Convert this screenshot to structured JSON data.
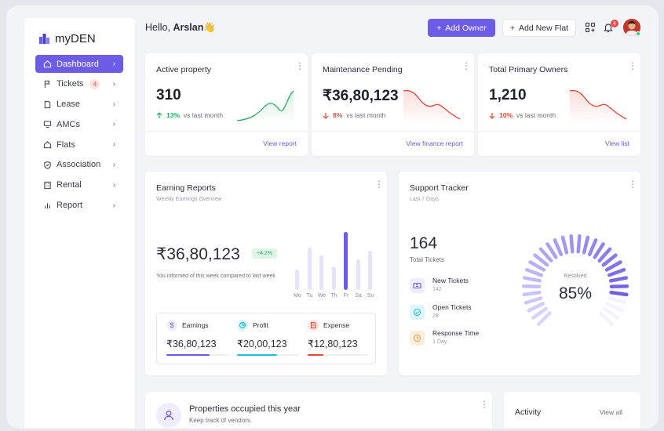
{
  "app": {
    "name": "myDEN"
  },
  "colors": {
    "accent": "#6c5ce7",
    "up": "#27ae60",
    "down": "#e5483a",
    "expense": "#e5483a",
    "profit": "#1ec1e6"
  },
  "sidebar": {
    "items": [
      {
        "label": "Dashboard",
        "icon": "home-icon",
        "active": true
      },
      {
        "label": "Tickets",
        "icon": "flag-icon",
        "badge": "4"
      },
      {
        "label": "Lease",
        "icon": "document-icon"
      },
      {
        "label": "AMCs",
        "icon": "monitor-icon"
      },
      {
        "label": "Flats",
        "icon": "home-outline-icon"
      },
      {
        "label": "Association",
        "icon": "shield-icon"
      },
      {
        "label": "Rental",
        "icon": "building-icon"
      },
      {
        "label": "Report",
        "icon": "bar-chart-icon"
      }
    ]
  },
  "header": {
    "greeting_prefix": "Hello, ",
    "user_name": "Arslan",
    "wave": "👋",
    "add_owner": "Add Owner",
    "add_flat": "Add New Flat",
    "notification_count": "4"
  },
  "kpis": [
    {
      "title": "Active property",
      "value": "310",
      "change": "13%",
      "direction": "up",
      "note": "vs last month",
      "link": "View report"
    },
    {
      "title": "Maintenance Pending",
      "value": "₹36,80,123",
      "change": "8%",
      "direction": "down",
      "note": "vs last month",
      "link": "View finance report"
    },
    {
      "title": "Total Primary Owners",
      "value": "1,210",
      "change": "10%",
      "direction": "down",
      "note": "vs last month",
      "link": "View list"
    }
  ],
  "earnings": {
    "title": "Earning Reports",
    "subtitle": "Weekly Earnings Overview",
    "value": "₹36,80,123",
    "badge": "+4.2%",
    "note": "You informed of this week compared to last week",
    "days": [
      "Mo",
      "Tu",
      "We",
      "Th",
      "Fr",
      "Sa",
      "Su"
    ],
    "bar_levels": [
      0.33,
      0.68,
      0.55,
      0.38,
      0.92,
      0.49,
      0.63
    ],
    "highlight_index": 4,
    "breakdown": [
      {
        "label": "Earnings",
        "value": "₹36,80,123",
        "icon": "dollar-icon",
        "color": "#6c5ce7",
        "bg": "#efedfd",
        "fill": 0.7
      },
      {
        "label": "Profit",
        "value": "₹20,00,123",
        "icon": "pie-chart-icon",
        "color": "#1ec1e6",
        "bg": "#dcf6fc",
        "fill": 0.65
      },
      {
        "label": "Expense",
        "value": "₹12,80,123",
        "icon": "expense-icon",
        "color": "#e5483a",
        "bg": "#fde4e2",
        "fill": 0.25
      }
    ]
  },
  "support": {
    "title": "Support Tracker",
    "subtitle": "Last 7 Days",
    "total": "164",
    "total_label": "Total Tickets",
    "items": [
      {
        "name": "New Tickets",
        "value": "142",
        "icon": "ticket-icon",
        "color": "#6c5ce7",
        "bg": "#efedfd"
      },
      {
        "name": "Open Tickets",
        "value": "28",
        "icon": "check-circle-icon",
        "color": "#1ec1e6",
        "bg": "#dcf6fc"
      },
      {
        "name": "Response Time",
        "value": "1 Day",
        "icon": "clock-icon",
        "color": "#f39c4a",
        "bg": "#fdeedd"
      }
    ],
    "gauge_label": "Resolved",
    "gauge_value": "85%",
    "gauge_fraction": 0.85
  },
  "properties": {
    "title": "Properties occupied this year",
    "subtitle": "Keep track of vendors."
  },
  "activity": {
    "title": "Activity",
    "link": "View all"
  }
}
